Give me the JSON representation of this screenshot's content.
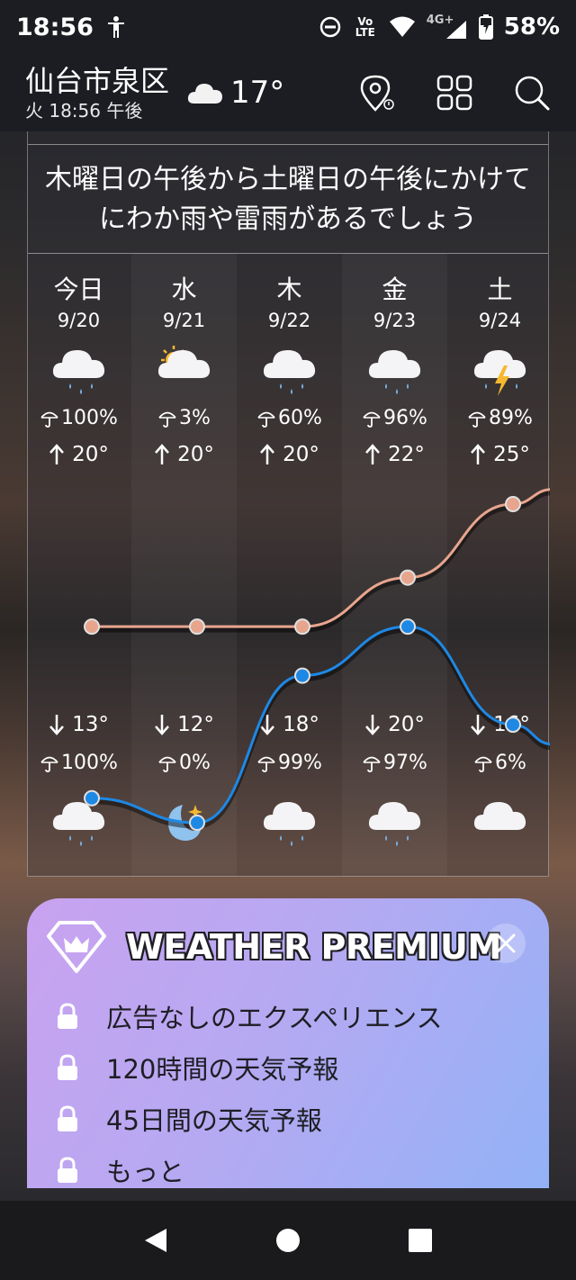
{
  "status_bar": {
    "time": "18:56",
    "network_volte": "Vo LTE",
    "network_type": "4G+",
    "battery_percent": "58%",
    "icons": [
      "accessibility-icon",
      "dnd-icon",
      "volte-icon",
      "wifi-icon",
      "signal-icon",
      "battery-charging-icon"
    ]
  },
  "header": {
    "city": "仙台市泉区",
    "subtitle": "火 18:56 午後",
    "current_icon": "cloud-icon",
    "current_temp": "17°",
    "icons": [
      "location-icon",
      "grid-icon",
      "search-icon"
    ]
  },
  "forecast": {
    "summary": "木曜日の午後から土曜日の午後にかけてにわか雨や雷雨があるでしょう",
    "days": [
      {
        "name": "今日",
        "date": "9/20",
        "day_icon": "rain-cloud-icon",
        "day_pop": "100%",
        "high": "20°",
        "low": "13°",
        "night_pop": "100%",
        "night_icon": "rain-cloud-icon"
      },
      {
        "name": "水",
        "date": "9/21",
        "day_icon": "partly-sunny-icon",
        "day_pop": "3%",
        "high": "20°",
        "low": "12°",
        "night_pop": "0%",
        "night_icon": "moon-stars-icon"
      },
      {
        "name": "木",
        "date": "9/22",
        "day_icon": "rain-cloud-icon",
        "day_pop": "60%",
        "high": "20°",
        "low": "18°",
        "night_pop": "99%",
        "night_icon": "rain-cloud-icon"
      },
      {
        "name": "金",
        "date": "9/23",
        "day_icon": "rain-cloud-icon",
        "day_pop": "96%",
        "high": "22°",
        "low": "20°",
        "night_pop": "97%",
        "night_icon": "rain-cloud-icon"
      },
      {
        "name": "土",
        "date": "9/24",
        "day_icon": "thunderstorm-icon",
        "day_pop": "89%",
        "high": "25°",
        "low": "16°",
        "night_pop": "6%",
        "night_icon": "cloud-icon"
      }
    ],
    "colors": {
      "high_line": "#e8a58e",
      "low_line": "#1e88e5"
    }
  },
  "premium": {
    "title": "WEATHER PREMIUM",
    "features": [
      "広告なしのエクスペリエンス",
      "120時間の天気予報",
      "45日間の天気予報",
      "もっと"
    ]
  },
  "nav": {
    "icons": [
      "back-icon",
      "home-icon",
      "recents-icon"
    ]
  }
}
